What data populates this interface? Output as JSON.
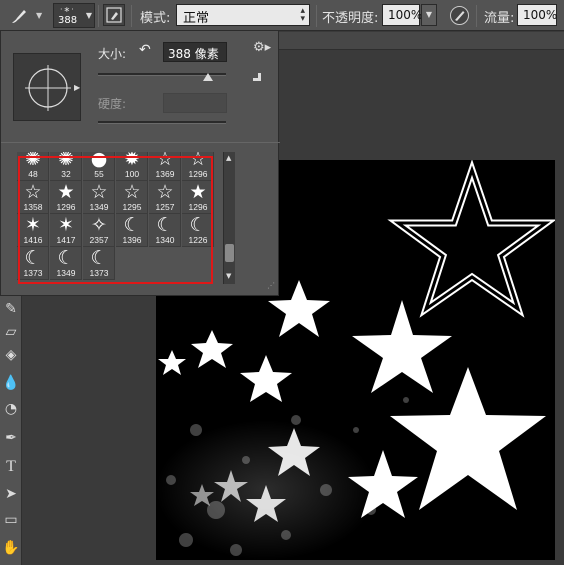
{
  "options_bar": {
    "brush_size": "388",
    "mode_label": "模式:",
    "mode_value": "正常",
    "opacity_label": "不透明度:",
    "opacity_value": "100%",
    "flow_label": "流量:",
    "flow_value": "100%"
  },
  "brush_panel": {
    "size_label": "大小:",
    "size_value": "388 像素",
    "size_fraction": 0.86,
    "hardness_label": "硬度:",
    "presets": [
      {
        "size": "48",
        "glyph": "✺"
      },
      {
        "size": "32",
        "glyph": "✺"
      },
      {
        "size": "55",
        "glyph": "●"
      },
      {
        "size": "100",
        "glyph": "✹"
      },
      {
        "size": "1369",
        "glyph": "☆"
      },
      {
        "size": "1296",
        "glyph": "☆"
      },
      {
        "size": "1358",
        "glyph": "☆"
      },
      {
        "size": "1296",
        "glyph": "★"
      },
      {
        "size": "1349",
        "glyph": "☆"
      },
      {
        "size": "1295",
        "glyph": "☆"
      },
      {
        "size": "1257",
        "glyph": "☆"
      },
      {
        "size": "1296",
        "glyph": "★"
      },
      {
        "size": "1416",
        "glyph": "✶"
      },
      {
        "size": "1417",
        "glyph": "✶"
      },
      {
        "size": "2357",
        "glyph": "✧"
      },
      {
        "size": "1396",
        "glyph": "☾"
      },
      {
        "size": "1340",
        "glyph": "☾"
      },
      {
        "size": "1226",
        "glyph": "☾"
      },
      {
        "size": "1373",
        "glyph": "☾"
      },
      {
        "size": "1349",
        "glyph": "☾"
      },
      {
        "size": "1373",
        "glyph": "☾"
      }
    ]
  },
  "colors": {
    "ui_gray": "#535353",
    "canvas": "#000000",
    "highlight": "#e01818"
  }
}
